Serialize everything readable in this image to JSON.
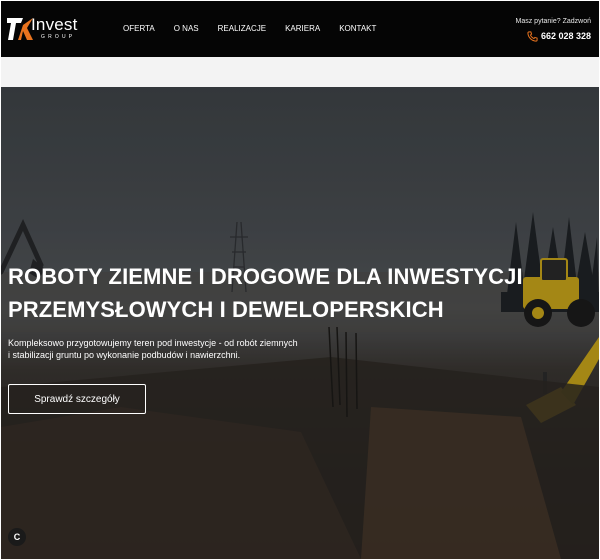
{
  "brand": {
    "name": "Invest",
    "tagline": "GROUP",
    "accent_color": "#e8731e"
  },
  "nav": {
    "items": [
      {
        "label": "OFERTA"
      },
      {
        "label": "O NAS"
      },
      {
        "label": "REALIZACJE"
      },
      {
        "label": "KARIERA"
      },
      {
        "label": "KONTAKT"
      }
    ]
  },
  "contact": {
    "question": "Masz pytanie? Zadzwoń",
    "phone": "662 028 328",
    "icon": "phone-icon"
  },
  "hero": {
    "title_line1": "ROBOTY ZIEMNE I DROGOWE DLA INWESTYCJI",
    "title_line2": "PRZEMYSŁOWYCH I DEWELOPERSKICH",
    "text_line1": "Kompleksowo przygotowujemy teren pod inwestycje - od robót ziemnych",
    "text_line2": "i stabilizacji gruntu po wykonanie podbudów i nawierzchni.",
    "cta_label": "Sprawdź szczegóły",
    "machine_color": "#d9b41c"
  },
  "corner_badge": {
    "label": "C"
  }
}
